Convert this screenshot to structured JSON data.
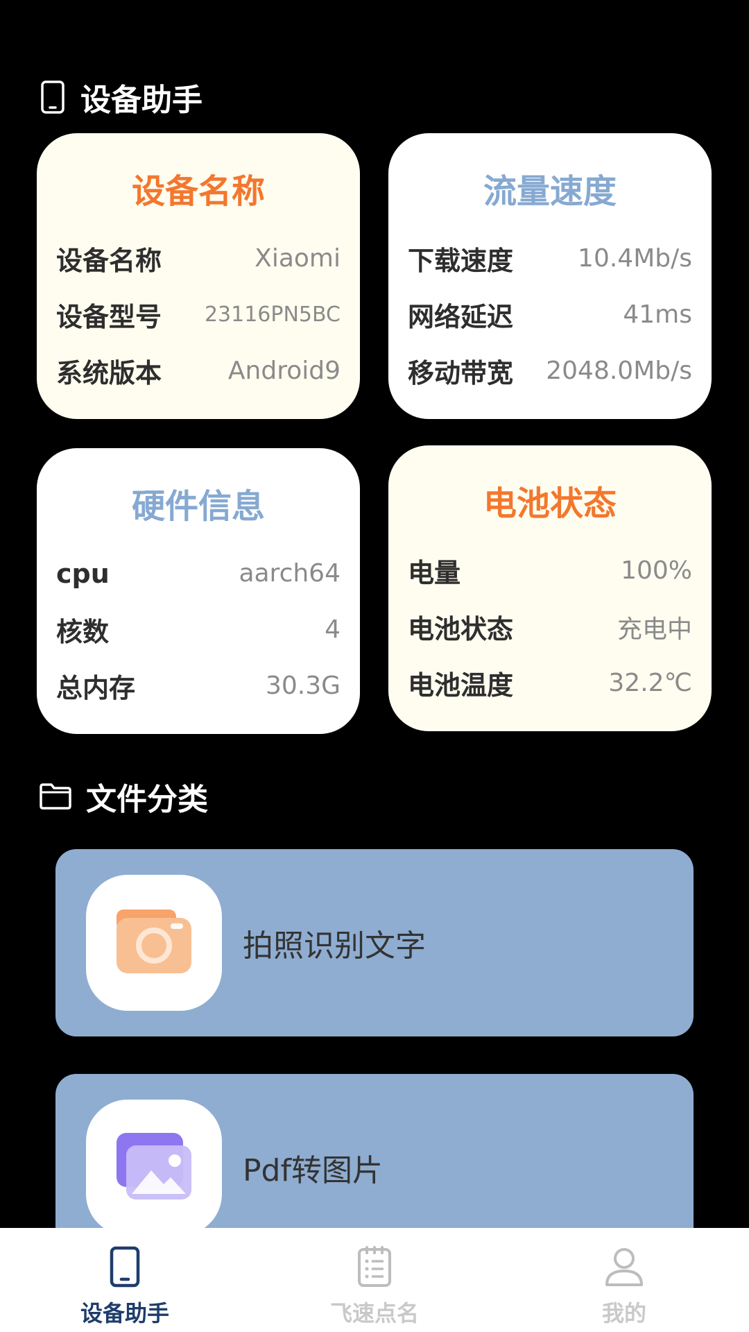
{
  "sections": {
    "device_assistant": {
      "title": "设备助手",
      "icon": "phone-icon"
    },
    "file_category": {
      "title": "文件分类",
      "icon": "folder-icon"
    }
  },
  "cards": {
    "device": {
      "title": "设备名称",
      "rows": [
        {
          "label": "设备名称",
          "value": "Xiaomi"
        },
        {
          "label": "设备型号",
          "value": "23116PN5BC"
        },
        {
          "label": "系统版本",
          "value": "Android9"
        }
      ]
    },
    "traffic": {
      "title": "流量速度",
      "rows": [
        {
          "label": "下载速度",
          "value": "10.4Mb/s"
        },
        {
          "label": "网络延迟",
          "value": "41ms"
        },
        {
          "label": "移动带宽",
          "value": "2048.0Mb/s"
        }
      ]
    },
    "hardware": {
      "title": "硬件信息",
      "rows": [
        {
          "label": "cpu",
          "value": "aarch64"
        },
        {
          "label": "核数",
          "value": "4"
        },
        {
          "label": "总内存",
          "value": "30.3G"
        }
      ]
    },
    "battery": {
      "title": "电池状态",
      "rows": [
        {
          "label": "电量",
          "value": "100%"
        },
        {
          "label": "电池状态",
          "value": "充电中"
        },
        {
          "label": "电池温度",
          "value": "32.2℃"
        }
      ]
    }
  },
  "file_items": [
    {
      "label": "拍照识别文字",
      "icon": "camera-icon"
    },
    {
      "label": "Pdf转图片",
      "icon": "image-icon"
    }
  ],
  "nav": [
    {
      "label": "设备助手",
      "icon": "phone-icon",
      "active": true
    },
    {
      "label": "飞速点名",
      "icon": "list-icon",
      "active": false
    },
    {
      "label": "我的",
      "icon": "user-icon",
      "active": false
    }
  ],
  "colors": {
    "accent_orange": "#f3772e",
    "accent_blue": "#86a9d1",
    "file_card_bg": "#8fadd1",
    "nav_active": "#1e3d6b",
    "nav_inactive": "#c9c9c9"
  }
}
